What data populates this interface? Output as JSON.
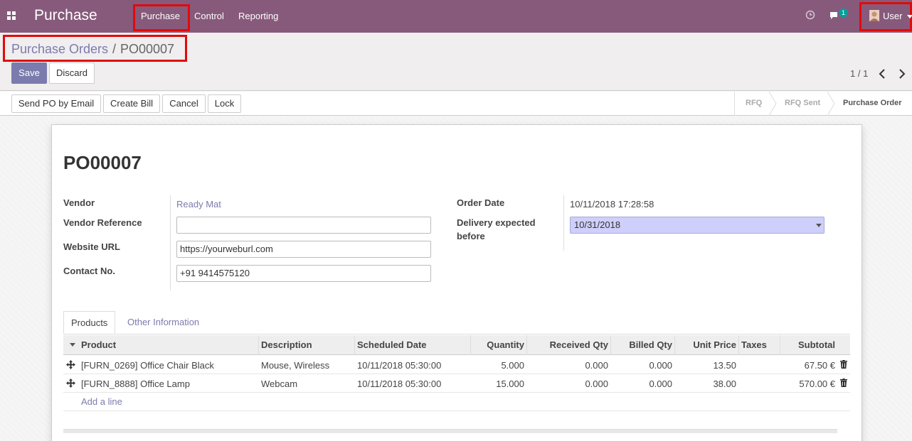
{
  "navbar": {
    "app_title": "Purchase",
    "menus": [
      "Purchase",
      "Control",
      "Reporting"
    ],
    "messages_badge": "1",
    "user_label": "User",
    "color": "#875a7b"
  },
  "breadcrumb": {
    "parent": "Purchase Orders",
    "separator": "/",
    "current": "PO00007"
  },
  "toolbar": {
    "save_label": "Save",
    "discard_label": "Discard",
    "pager": "1 / 1"
  },
  "statusbar": {
    "actions": [
      "Send PO by Email",
      "Create Bill",
      "Cancel",
      "Lock"
    ],
    "stages": [
      "RFQ",
      "RFQ Sent",
      "Purchase Order"
    ],
    "active_stage": "Purchase Order"
  },
  "form": {
    "title": "PO00007",
    "vendor_label": "Vendor",
    "vendor_value": "Ready Mat",
    "vendor_reference_label": "Vendor Reference",
    "vendor_reference_value": "",
    "website_label": "Website URL",
    "website_value": "https://yourweburl.com",
    "contact_label": "Contact No.",
    "contact_value": "+91 9414575120",
    "order_date_label": "Order Date",
    "order_date_value": "10/11/2018 17:28:58",
    "delivery_label_line1": "Delivery expected",
    "delivery_label_line2": "before",
    "delivery_value": "10/31/2018"
  },
  "tabs": [
    "Products",
    "Other Information"
  ],
  "table": {
    "columns": [
      "Product",
      "Description",
      "Scheduled Date",
      "Quantity",
      "Received Qty",
      "Billed Qty",
      "Unit Price",
      "Taxes",
      "Subtotal"
    ],
    "rows": [
      {
        "product": "[FURN_0269] Office Chair Black",
        "description": "Mouse, Wireless",
        "scheduled": "10/11/2018 05:30:00",
        "quantity": "5.000",
        "received": "0.000",
        "billed": "0.000",
        "unit_price": "13.50",
        "taxes": "",
        "subtotal": "67.50 €"
      },
      {
        "product": "[FURN_8888] Office Lamp",
        "description": "Webcam",
        "scheduled": "10/11/2018 05:30:00",
        "quantity": "15.000",
        "received": "0.000",
        "billed": "0.000",
        "unit_price": "38.00",
        "taxes": "",
        "subtotal": "570.00 €"
      }
    ],
    "add_line": "Add a line"
  }
}
